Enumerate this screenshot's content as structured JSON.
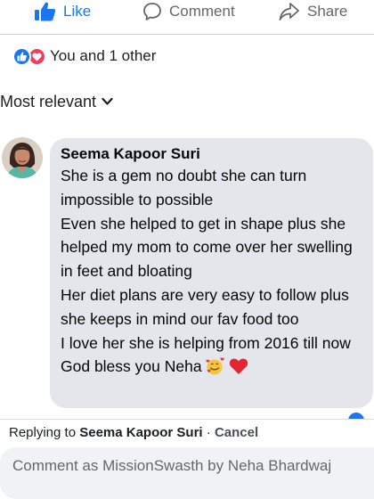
{
  "actions": {
    "like_label": "Like",
    "comment_label": "Comment",
    "share_label": "Share",
    "like_color": "#1877f2",
    "like_icon": "thumbs-up-icon",
    "comment_icon": "speech-bubble-icon",
    "share_icon": "share-arrow-icon"
  },
  "reactions": {
    "summary": "You and 1 other",
    "icons": [
      "like-reaction-icon",
      "love-reaction-icon"
    ]
  },
  "sort": {
    "label": "Most relevant",
    "icon": "chevron-down-icon"
  },
  "comment": {
    "author": "Seema Kapoor Suri",
    "text": "She is a gem no doubt she can turn impossible to possible\nEven she helped to get in shape plus she helped my mom to come over her swelling in feet and bloating\nHer diet plans are very easy to follow plus she keeps in mind our fav food too\nI love her she is helping from 2016 till now\nGod bless you Neha",
    "emojis": [
      "smiling-face-with-hearts-icon",
      "red-heart-icon"
    ],
    "bubble_color": "#e4e6eb"
  },
  "reply": {
    "prefix": "Replying to",
    "target": "Seema Kapoor Suri",
    "separator": "·",
    "cancel_label": "Cancel"
  },
  "composer": {
    "placeholder": "Comment as MissionSwasth by Neha Bhardwaj"
  }
}
